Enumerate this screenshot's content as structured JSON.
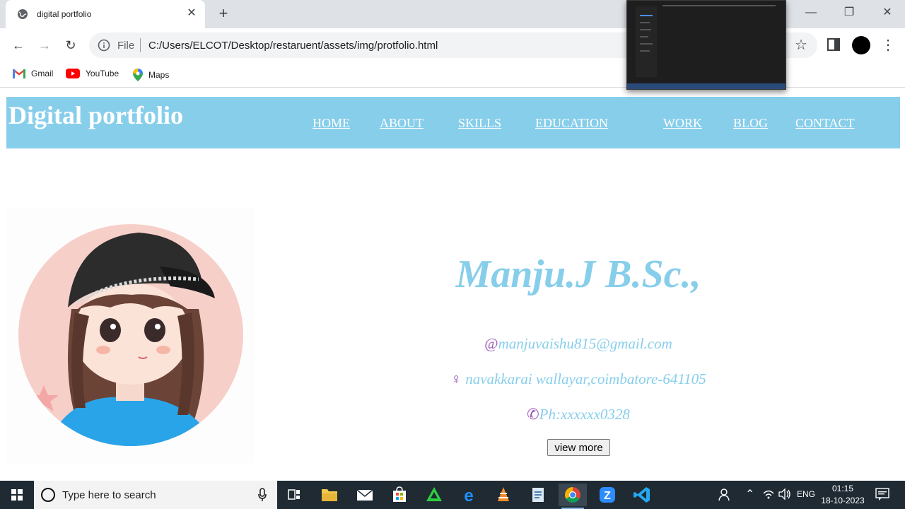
{
  "browser": {
    "tab_title": "digital portfolio",
    "url_scheme": "File",
    "url": "C:/Users/ELCOT/Desktop/restaruent/assets/img/protfolio.html",
    "bookmarks": [
      "Gmail",
      "YouTube",
      "Maps"
    ]
  },
  "site": {
    "brand": "Digital portfolio",
    "nav": [
      "HOME",
      "ABOUT",
      "SKILLS",
      "EDUCATION",
      "WORK",
      "BLOG",
      "CONTACT"
    ],
    "name": "Manju.J B.Sc.,",
    "email_icon": "@",
    "email": "manjuvaishu815@gmail.com",
    "location_icon": "♀",
    "location": " navakkarai wallayar,coimbatore-641105",
    "phone_icon": "✆",
    "phone": "Ph:xxxxxx0328",
    "view_more": "view more"
  },
  "taskbar": {
    "search_placeholder": "Type here to search",
    "language": "ENG",
    "time": "01:15",
    "date": "18-10-2023"
  },
  "colors": {
    "accent": "#87ceeb",
    "icon_purple": "#9b59b6",
    "taskbar": "#1f2a33"
  }
}
